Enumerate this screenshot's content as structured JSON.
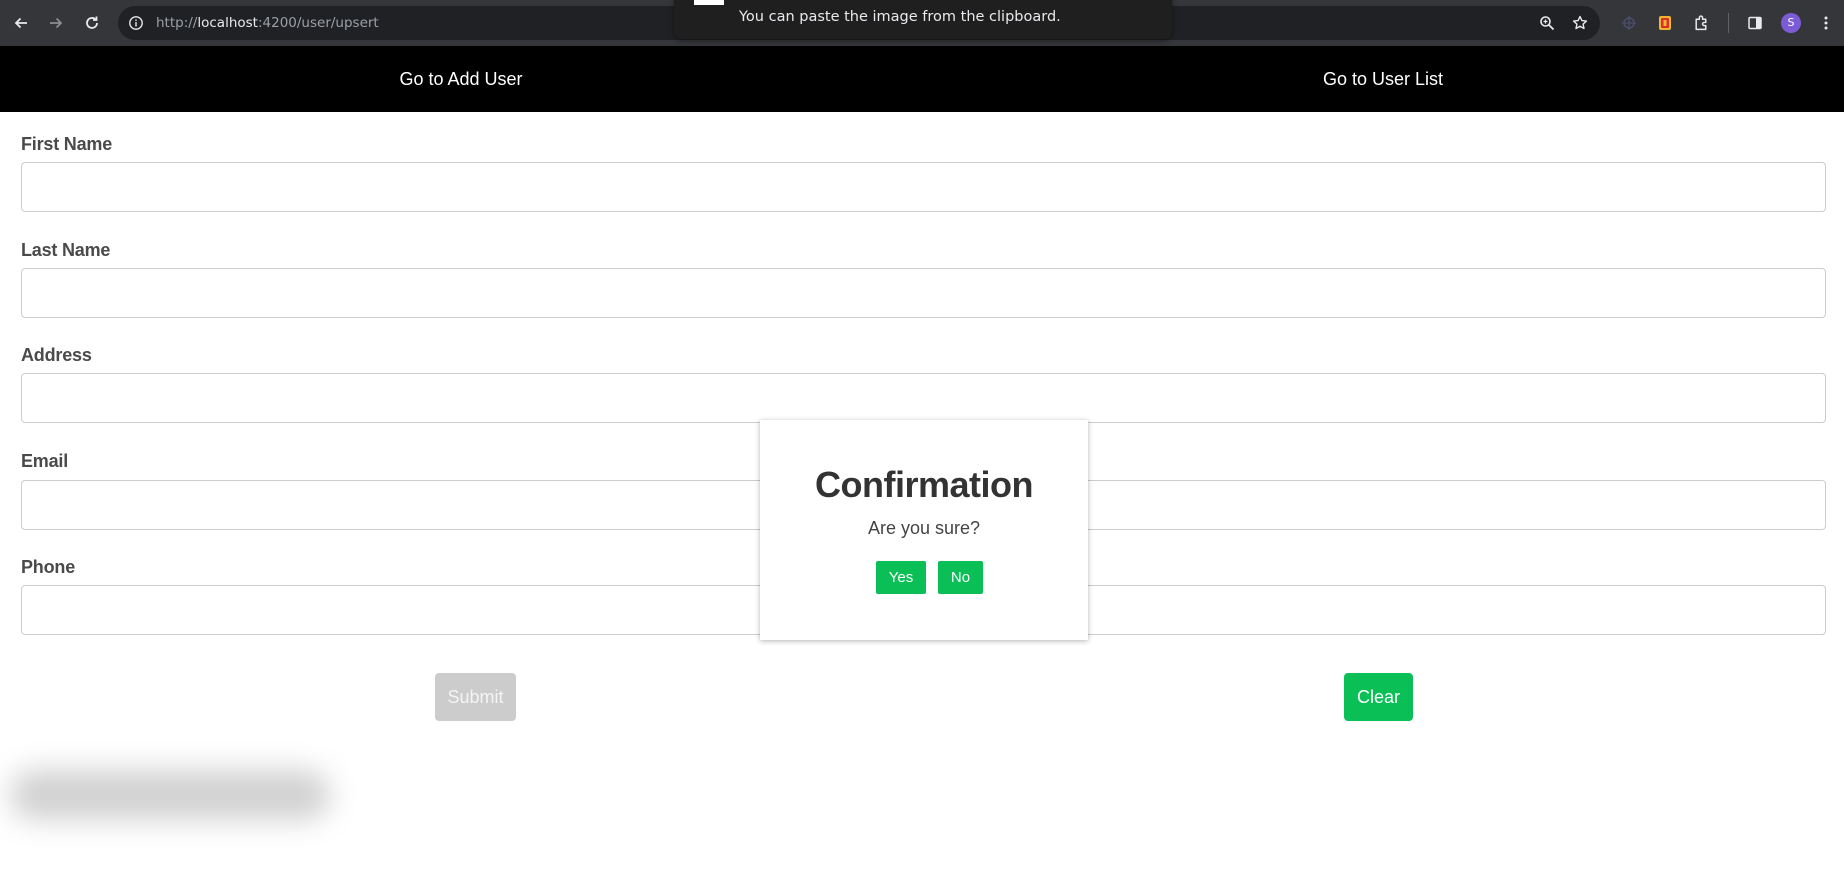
{
  "browser": {
    "url_scheme": "http://",
    "url_host": "localhost",
    "url_path": ":4200/user/upsert",
    "profile_initial": "S"
  },
  "clipboard_toast": {
    "message": "You can paste the image from the clipboard."
  },
  "nav": {
    "add_user": "Go to Add User",
    "user_list": "Go to User List"
  },
  "form": {
    "fields": [
      {
        "label": "First Name",
        "value": ""
      },
      {
        "label": "Last Name",
        "value": ""
      },
      {
        "label": "Address",
        "value": ""
      },
      {
        "label": "Email",
        "value": ""
      },
      {
        "label": "Phone",
        "value": ""
      }
    ],
    "submit_label": "Submit",
    "clear_label": "Clear",
    "submit_disabled": true
  },
  "modal": {
    "title": "Confirmation",
    "message": "Are you sure?",
    "yes_label": "Yes",
    "no_label": "No"
  },
  "colors": {
    "accent_green": "#0bbf57",
    "disabled_gray": "#cccccc",
    "nav_background": "#000000",
    "browser_chrome": "#35363a"
  },
  "icons": {
    "browser_toolbar": [
      "back-arrow-icon",
      "forward-arrow-icon",
      "reload-icon",
      "site-info-icon",
      "zoom-icon",
      "bookmark-star-icon",
      "extension-icon",
      "puzzle-extensions-icon",
      "side-panel-icon",
      "kebab-menu-icon"
    ]
  }
}
